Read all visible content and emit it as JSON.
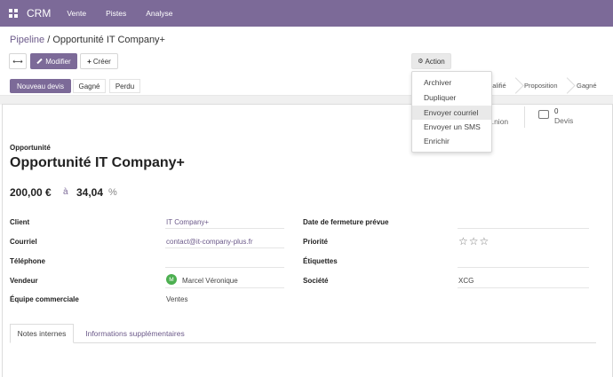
{
  "navbar": {
    "brand": "CRM",
    "menu": [
      "Vente",
      "Pistes",
      "Analyse"
    ],
    "color": "#7c6a98"
  },
  "breadcrumb": {
    "parent": "Pipeline",
    "separator": " / ",
    "current": "Opportunité IT Company+"
  },
  "toolbar": {
    "expand_icon": "⟷",
    "edit_label": "Modifier",
    "create_label": "Créer",
    "action_label": "Action"
  },
  "statusbar": {
    "new_quote_label": "Nouveau devis",
    "won_label": "Gagné",
    "lost_label": "Perdu",
    "stages": [
      "...alifié",
      "Proposition",
      "Gagné"
    ]
  },
  "action_menu": {
    "items": [
      "Archiver",
      "Dupliquer",
      "Envoyer courriel",
      "Envoyer un SMS",
      "Enrichir"
    ],
    "active_index": 2
  },
  "stats": {
    "meetings_label": "...nion",
    "quotes_count": "0",
    "quotes_label": "Devis"
  },
  "form": {
    "label": "Opportunité",
    "title": "Opportunité IT Company+",
    "expected_revenue": "200,00 €",
    "at_label": "à",
    "probability": "34,04",
    "percent_sign": "%",
    "fields_left": [
      {
        "label": "Client",
        "value": "IT Company+"
      },
      {
        "label": "Courriel",
        "value": "contact@it-company-plus.fr"
      },
      {
        "label": "Téléphone",
        "value": ""
      },
      {
        "label": "Vendeur",
        "value": "Marcel Véronique"
      },
      {
        "label": "Équipe commerciale",
        "value": "Ventes"
      }
    ],
    "fields_right": [
      {
        "label": "Date de fermeture prévue",
        "value": ""
      },
      {
        "label": "Priorité",
        "value": "☆☆☆"
      },
      {
        "label": "Étiquettes",
        "value": ""
      },
      {
        "label": "Société",
        "value": "XCG"
      }
    ],
    "salesperson_initial": "M",
    "avatar_color": "#4caf50"
  },
  "tabs": [
    "Notes internes",
    "Informations supplémentaires"
  ]
}
